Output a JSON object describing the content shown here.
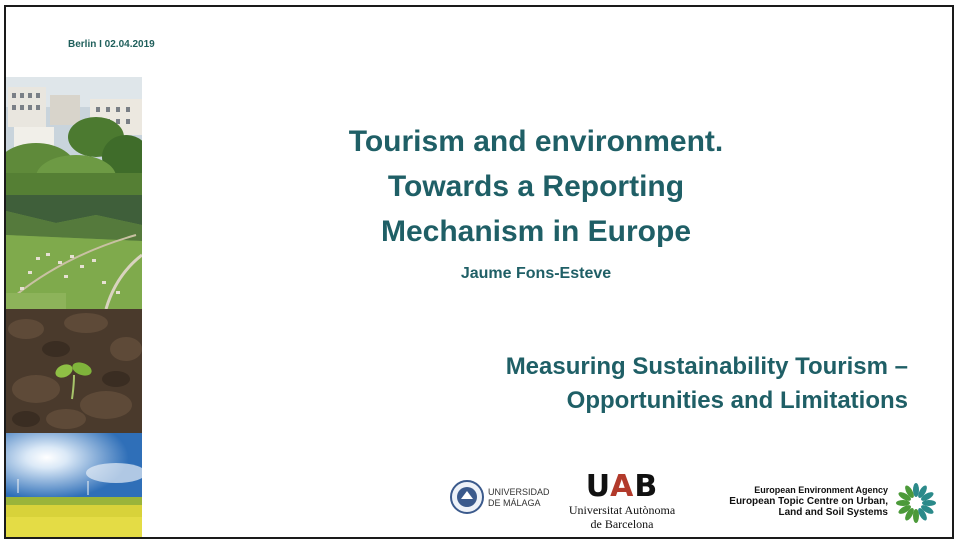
{
  "slide": {
    "dateline": "Berlin I 02.04.2019",
    "title_lines": [
      "Tourism and environment.",
      "Towards a Reporting",
      "Mechanism in Europe"
    ],
    "author": "Jaume Fons-Esteve",
    "subtitle_lines": [
      "Measuring Sustainability Tourism –",
      "Opportunities and Limitations"
    ]
  },
  "logos": {
    "uma": {
      "line1": "UNIVERSIDAD",
      "line2": "DE MÁLAGA"
    },
    "uab": {
      "mark_u": "U",
      "mark_a": "A",
      "mark_b": "B",
      "line1": "Universitat Autònoma",
      "line2": "de Barcelona"
    },
    "eea": {
      "line1": "European Environment Agency",
      "line2": "European Topic Centre on Urban,",
      "line3": "Land and Soil Systems"
    }
  },
  "colors": {
    "accent": "#1f5f66",
    "uab_red": "#b23a2b"
  },
  "images": [
    "city-buildings-photo",
    "alpine-valley-photo",
    "seedling-soil-photo",
    "sunny-field-photo"
  ]
}
